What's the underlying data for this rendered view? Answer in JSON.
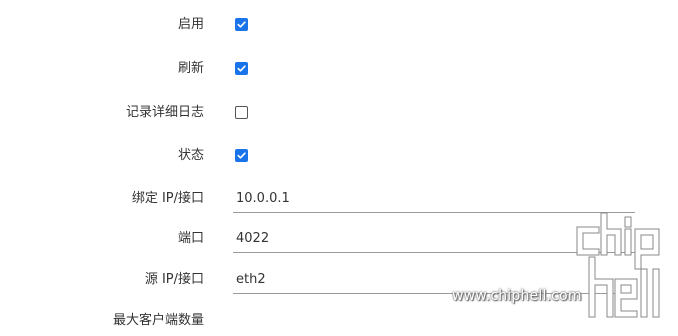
{
  "fields": {
    "enable": {
      "label": "启用",
      "checked": true
    },
    "refresh": {
      "label": "刷新",
      "checked": true
    },
    "verbose_log": {
      "label": "记录详细日志",
      "checked": false
    },
    "status": {
      "label": "状态",
      "checked": true
    },
    "bind_ip": {
      "label": "绑定 IP/接口",
      "value": "10.0.0.1"
    },
    "port": {
      "label": "端口",
      "value": "4022"
    },
    "source_ip": {
      "label": "源 IP/接口",
      "value": "eth2"
    },
    "max_clients": {
      "label": "最大客户端数量"
    }
  },
  "watermark": {
    "text": "www.chiphell.com"
  },
  "colors": {
    "accent": "#1a73e8",
    "text": "#333333",
    "underline": "#9a9a9a"
  }
}
